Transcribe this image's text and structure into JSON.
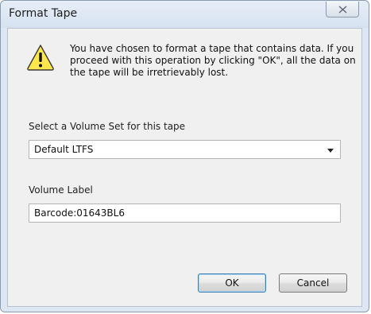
{
  "window": {
    "title": "Format Tape"
  },
  "dialog": {
    "icon": "warning-icon",
    "message": "You have chosen to format a tape that contains data.  If you proceed with this operation by clicking \"OK\", all the data on the tape will be irretrievably lost.",
    "volume_set_label": "Select a Volume Set for this tape",
    "volume_set_value": "Default LTFS",
    "volume_label_label": "Volume Label",
    "volume_label_value": "Barcode:01643BL6"
  },
  "buttons": {
    "ok": "OK",
    "cancel": "Cancel"
  },
  "colors": {
    "frame": "#dde7f3",
    "client": "#f0f0f0",
    "warning_fill": "#fde74c",
    "default_button_border": "#3c7fb1"
  }
}
